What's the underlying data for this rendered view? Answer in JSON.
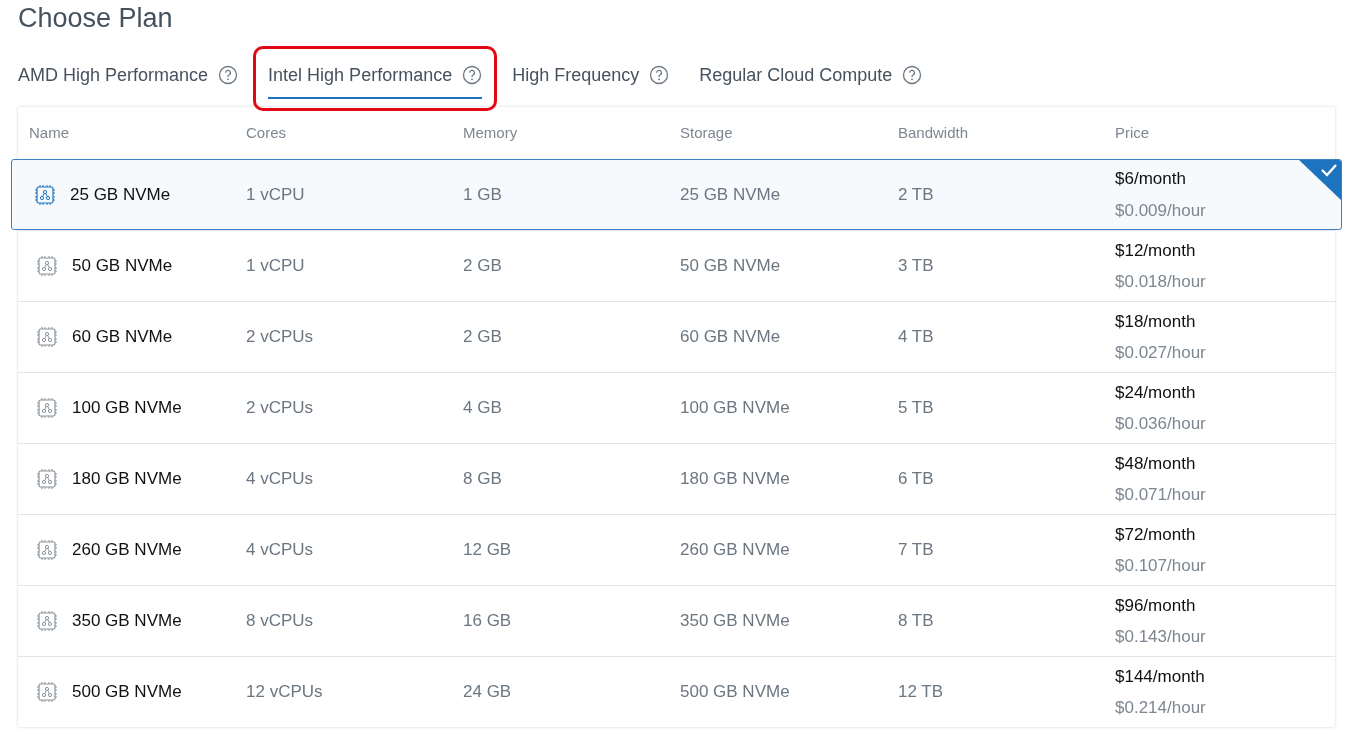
{
  "title": "Choose Plan",
  "tabs": [
    {
      "label": "AMD High Performance",
      "selected": false
    },
    {
      "label": "Intel High Performance",
      "selected": true
    },
    {
      "label": "High Frequency",
      "selected": false
    },
    {
      "label": "Regular Cloud Compute",
      "selected": false
    }
  ],
  "table": {
    "columns": [
      "Name",
      "Cores",
      "Memory",
      "Storage",
      "Bandwidth",
      "Price"
    ],
    "rows": [
      {
        "name": "25 GB NVMe",
        "cores": "1 vCPU",
        "memory": "1 GB",
        "storage": "25 GB NVMe",
        "bandwidth": "2 TB",
        "monthly": "$6/month",
        "hourly": "$0.009/hour",
        "selected": true
      },
      {
        "name": "50 GB NVMe",
        "cores": "1 vCPU",
        "memory": "2 GB",
        "storage": "50 GB NVMe",
        "bandwidth": "3 TB",
        "monthly": "$12/month",
        "hourly": "$0.018/hour",
        "selected": false
      },
      {
        "name": "60 GB NVMe",
        "cores": "2 vCPUs",
        "memory": "2 GB",
        "storage": "60 GB NVMe",
        "bandwidth": "4 TB",
        "monthly": "$18/month",
        "hourly": "$0.027/hour",
        "selected": false
      },
      {
        "name": "100 GB NVMe",
        "cores": "2 vCPUs",
        "memory": "4 GB",
        "storage": "100 GB NVMe",
        "bandwidth": "5 TB",
        "monthly": "$24/month",
        "hourly": "$0.036/hour",
        "selected": false
      },
      {
        "name": "180 GB NVMe",
        "cores": "4 vCPUs",
        "memory": "8 GB",
        "storage": "180 GB NVMe",
        "bandwidth": "6 TB",
        "monthly": "$48/month",
        "hourly": "$0.071/hour",
        "selected": false
      },
      {
        "name": "260 GB NVMe",
        "cores": "4 vCPUs",
        "memory": "12 GB",
        "storage": "260 GB NVMe",
        "bandwidth": "7 TB",
        "monthly": "$72/month",
        "hourly": "$0.107/hour",
        "selected": false
      },
      {
        "name": "350 GB NVMe",
        "cores": "8 vCPUs",
        "memory": "16 GB",
        "storage": "350 GB NVMe",
        "bandwidth": "8 TB",
        "monthly": "$96/month",
        "hourly": "$0.143/hour",
        "selected": false
      },
      {
        "name": "500 GB NVMe",
        "cores": "12 vCPUs",
        "memory": "24 GB",
        "storage": "500 GB NVMe",
        "bandwidth": "12 TB",
        "monthly": "$144/month",
        "hourly": "$0.214/hour",
        "selected": false
      }
    ]
  }
}
